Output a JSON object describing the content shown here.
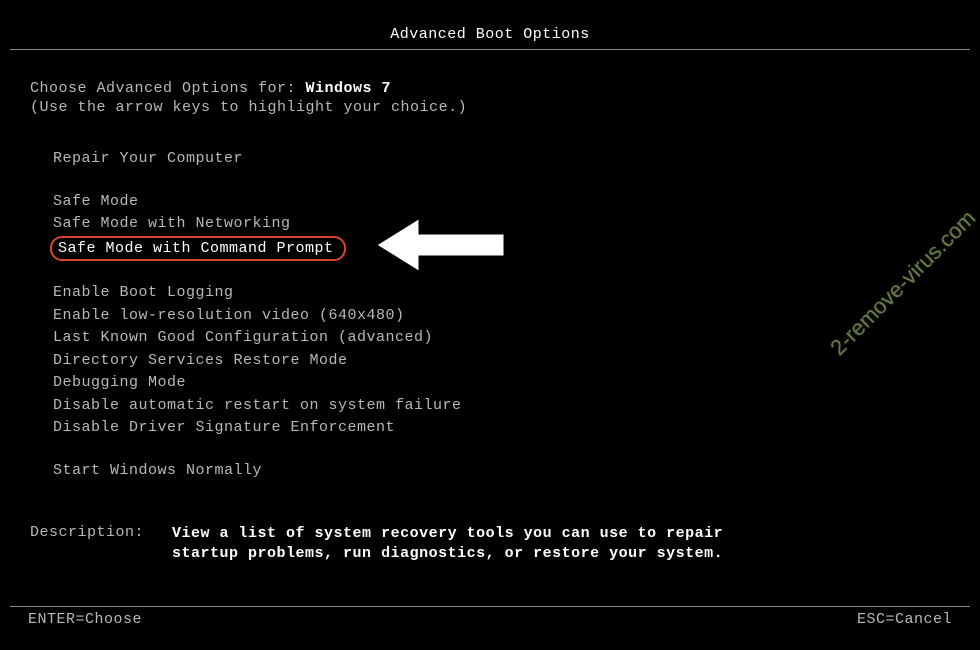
{
  "title": "Advanced Boot Options",
  "instruction": {
    "prefix": "Choose Advanced Options for: ",
    "os": "Windows 7",
    "hint": "(Use the arrow keys to highlight your choice.)"
  },
  "menu": {
    "repair": "Repair Your Computer",
    "safe_mode": "Safe Mode",
    "safe_mode_net": "Safe Mode with Networking",
    "safe_mode_cmd": "Safe Mode with Command Prompt",
    "boot_log": "Enable Boot Logging",
    "low_res": "Enable low-resolution video (640x480)",
    "lkgc": "Last Known Good Configuration (advanced)",
    "ds_restore": "Directory Services Restore Mode",
    "debug": "Debugging Mode",
    "no_restart": "Disable automatic restart on system failure",
    "no_sig": "Disable Driver Signature Enforcement",
    "start_normal": "Start Windows Normally"
  },
  "description": {
    "label": "Description:",
    "text": "View a list of system recovery tools you can use to repair startup problems, run diagnostics, or restore your system."
  },
  "footer": {
    "enter": "ENTER=Choose",
    "esc": "ESC=Cancel"
  },
  "watermark": "2-remove-virus.com"
}
